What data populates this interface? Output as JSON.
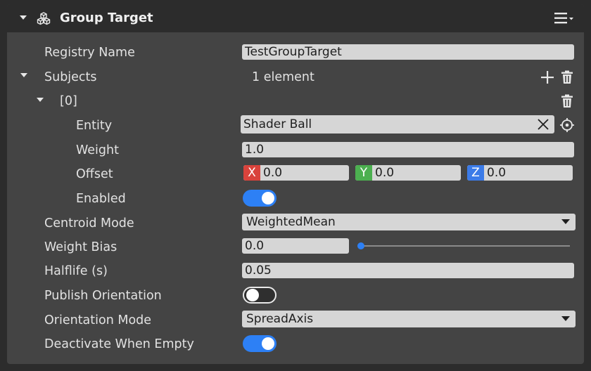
{
  "component": {
    "title": "Group Target",
    "icons": {
      "collapse": "triangle-down-icon",
      "component": "cubes-icon",
      "menu": "hamburger-menu-icon"
    }
  },
  "properties": {
    "registry_name": {
      "label": "Registry Name",
      "value": "TestGroupTarget"
    },
    "subjects": {
      "label": "Subjects",
      "count_text": "1 element",
      "items": [
        {
          "index_label": "[0]",
          "entity": {
            "label": "Entity",
            "value": "Shader Ball"
          },
          "weight": {
            "label": "Weight",
            "value": "1.0"
          },
          "offset": {
            "label": "Offset",
            "x": {
              "axis": "X",
              "value": "0.0",
              "color": "#d9433c"
            },
            "y": {
              "axis": "Y",
              "value": "0.0",
              "color": "#4cb050"
            },
            "z": {
              "axis": "Z",
              "value": "0.0",
              "color": "#3b7be8"
            }
          },
          "enabled": {
            "label": "Enabled",
            "value": true
          }
        }
      ]
    },
    "centroid_mode": {
      "label": "Centroid Mode",
      "value": "WeightedMean"
    },
    "weight_bias": {
      "label": "Weight Bias",
      "value": "0.0",
      "slider_fraction": 0.0
    },
    "halflife": {
      "label": "Halflife (s)",
      "value": "0.05"
    },
    "publish_orientation": {
      "label": "Publish Orientation",
      "value": false
    },
    "orientation_mode": {
      "label": "Orientation Mode",
      "value": "SpreadAxis"
    },
    "deactivate_when_empty": {
      "label": "Deactivate When Empty",
      "value": true
    }
  },
  "colors": {
    "accent": "#2d80f5",
    "panel_bg": "#444444",
    "header_bg": "#2c2c2c",
    "field_bg": "#d6d6d6"
  }
}
